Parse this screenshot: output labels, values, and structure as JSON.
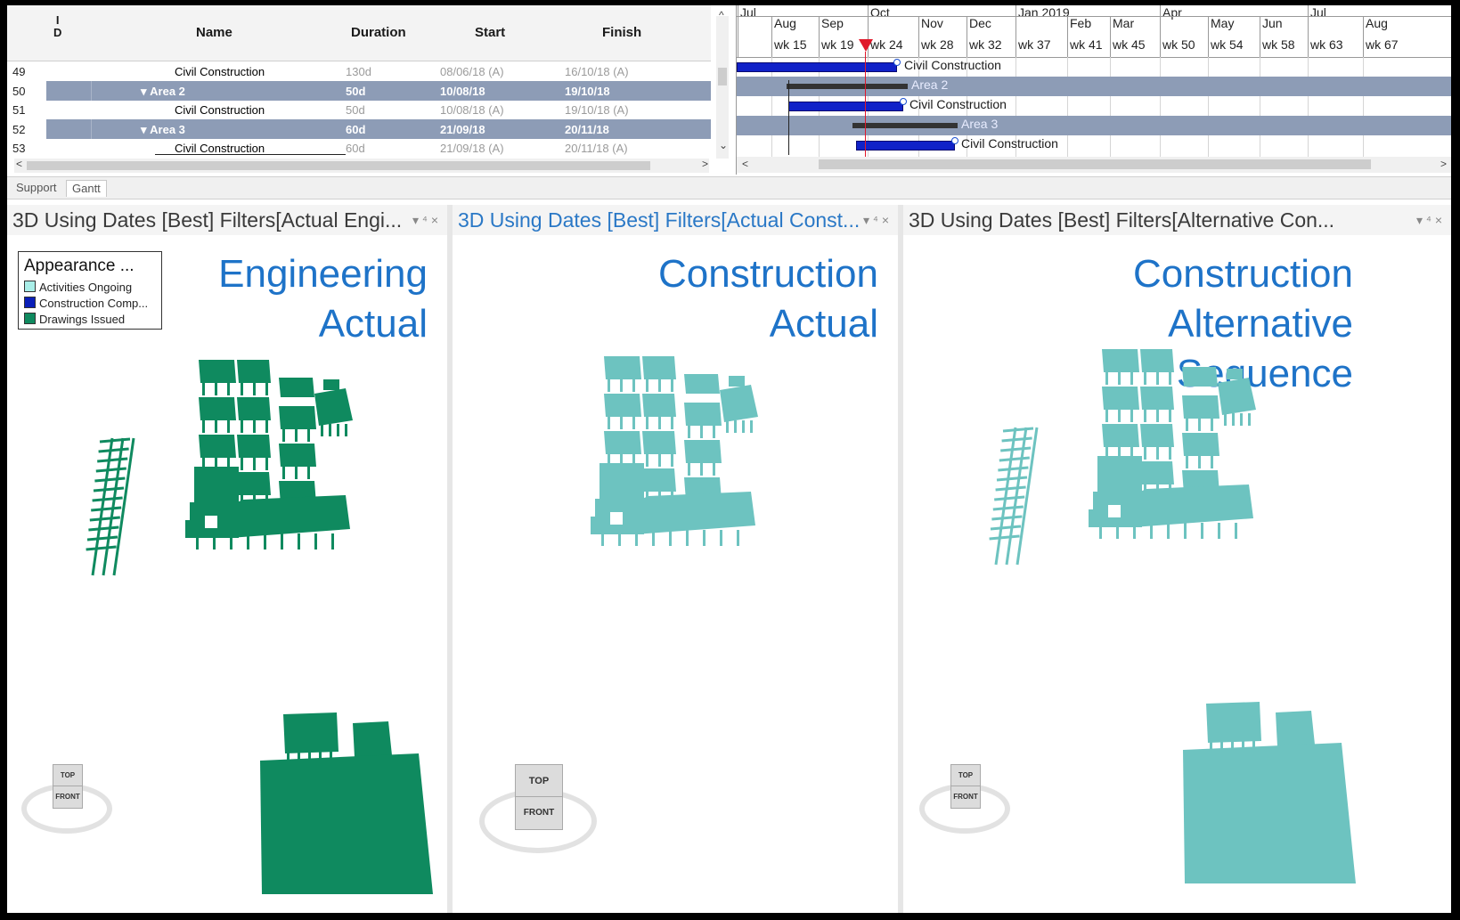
{
  "table": {
    "headers": {
      "id": "I\nD",
      "name": "Name",
      "duration": "Duration",
      "start": "Start",
      "finish": "Finish"
    },
    "rows": [
      {
        "id": "49",
        "name": "Civil Construction",
        "duration": "130d",
        "start": "08/06/18 (A)",
        "finish": "16/10/18 (A)",
        "selected": false
      },
      {
        "id": "50",
        "name": "Area 2",
        "duration": "50d",
        "start": "10/08/18",
        "finish": "19/10/18",
        "selected": true
      },
      {
        "id": "51",
        "name": "Civil Construction",
        "duration": "50d",
        "start": "10/08/18 (A)",
        "finish": "19/10/18 (A)",
        "selected": false
      },
      {
        "id": "52",
        "name": "Area 3",
        "duration": "60d",
        "start": "21/09/18",
        "finish": "20/11/18",
        "selected": true
      },
      {
        "id": "53",
        "name": "Civil Construction",
        "duration": "60d",
        "start": "21/09/18 (A)",
        "finish": "20/11/18 (A)",
        "selected": false
      }
    ]
  },
  "gantt": {
    "months": [
      "Jul",
      "Aug",
      "Sep",
      "Oct",
      "Nov",
      "Dec",
      "Jan 2019",
      "Feb",
      "Mar",
      "Apr",
      "May",
      "Jun",
      "Jul",
      "Aug"
    ],
    "weeks": [
      "wk 15",
      "wk 19",
      "wk 24",
      "wk 28",
      "wk 32",
      "wk 37",
      "wk 41",
      "wk 45",
      "wk 50",
      "wk 54",
      "wk 58",
      "wk 63",
      "wk 67"
    ],
    "bar_labels": [
      "Civil Construction",
      "Area 2",
      "Civil Construction",
      "Area 3",
      "Civil Construction"
    ]
  },
  "tabs": [
    "Support",
    "Gantt"
  ],
  "panes": [
    {
      "title": "3D Using Dates [Best] Filters[Actual Engi...",
      "overlay": [
        "Engineering",
        "Actual"
      ],
      "color": "#0f8a5f",
      "active": false
    },
    {
      "title": "3D Using Dates [Best] Filters[Actual Const...",
      "overlay": [
        "Construction",
        "Actual"
      ],
      "color": "#6dc3c0",
      "active": true
    },
    {
      "title": "3D Using Dates [Best] Filters[Alternative Con...",
      "overlay": [
        "Construction",
        "Alternative",
        "Sequence"
      ],
      "color": "#6dc3c0",
      "active": false
    }
  ],
  "pane_controls": "▾ ⁴ ×",
  "legend": {
    "title": "Appearance ...",
    "items": [
      {
        "label": "Activities Ongoing",
        "color": "#a9eee8"
      },
      {
        "label": "Construction Comp...",
        "color": "#0a1fb8"
      },
      {
        "label": "Drawings Issued",
        "color": "#0f8a5f"
      }
    ]
  },
  "viewcube": {
    "top": "TOP",
    "front": "FRONT"
  }
}
